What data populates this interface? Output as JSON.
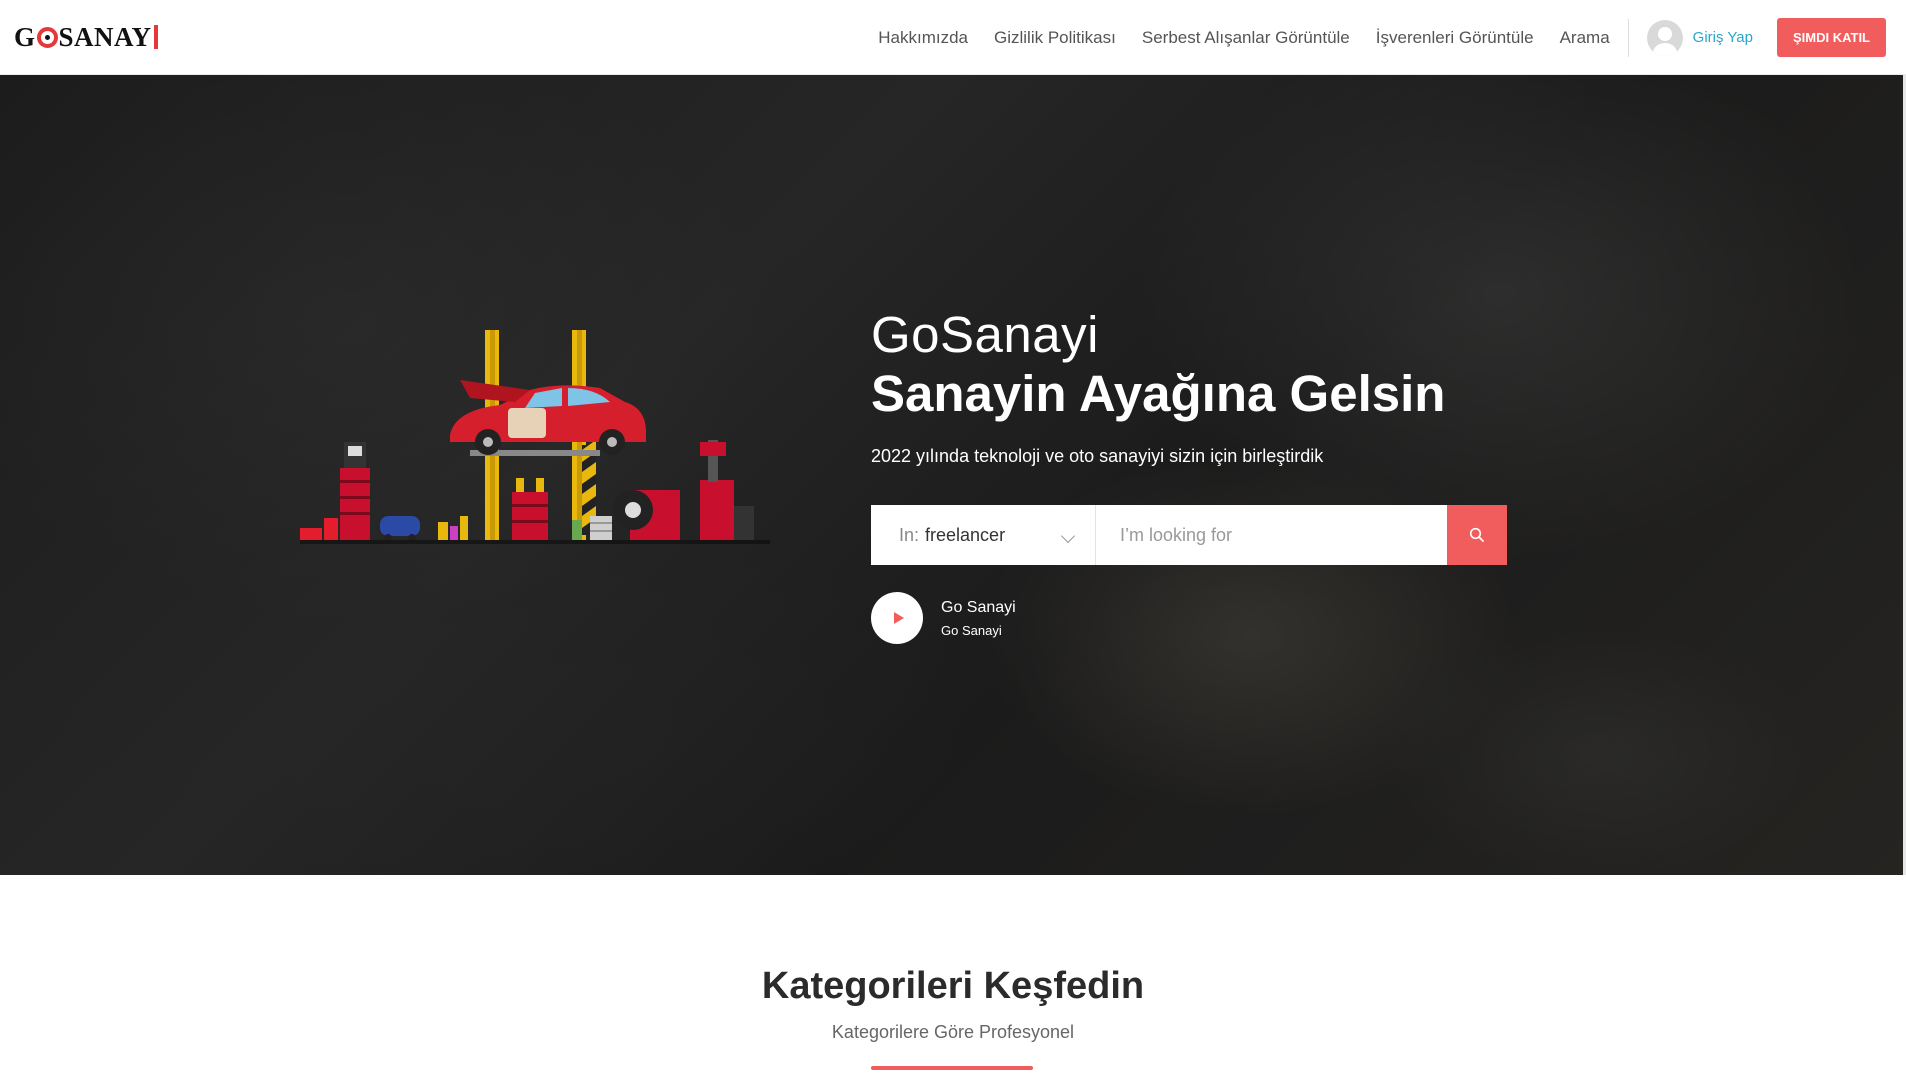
{
  "header": {
    "logo_text_1": "G",
    "logo_text_2": "SANAY",
    "nav": [
      {
        "label": "Hakkımızda"
      },
      {
        "label": "Gizlilik Politikası"
      },
      {
        "label": "Serbest Alışanlar Görüntüle"
      },
      {
        "label": "İşverenleri Görüntüle"
      },
      {
        "label": "Arama"
      }
    ],
    "login_label": "Giriş Yap",
    "join_label": "ŞIMDI KATIL"
  },
  "hero": {
    "title_line1": "GoSanayi",
    "title_line2": "Sanayin Ayağına Gelsin",
    "subtitle": "2022 yılında teknoloji ve oto sanayiyi sizin için birleştirdik",
    "search": {
      "select_prefix": "In:",
      "select_value": "freelancer",
      "placeholder": "I’m looking for"
    },
    "video": {
      "title": "Go Sanayi",
      "subtitle": "Go Sanayi"
    }
  },
  "categories": {
    "title": "Kategorileri Keşfedin",
    "subtitle": "Kategorilere Göre Profesyonel"
  },
  "colors": {
    "accent": "#f15d5d",
    "login_link": "#2aa7c9",
    "logo_red": "#e5383b"
  },
  "icons": {
    "search": "search-icon",
    "play": "play-icon",
    "chevron": "chevron-down-icon",
    "avatar": "user-avatar-icon"
  }
}
